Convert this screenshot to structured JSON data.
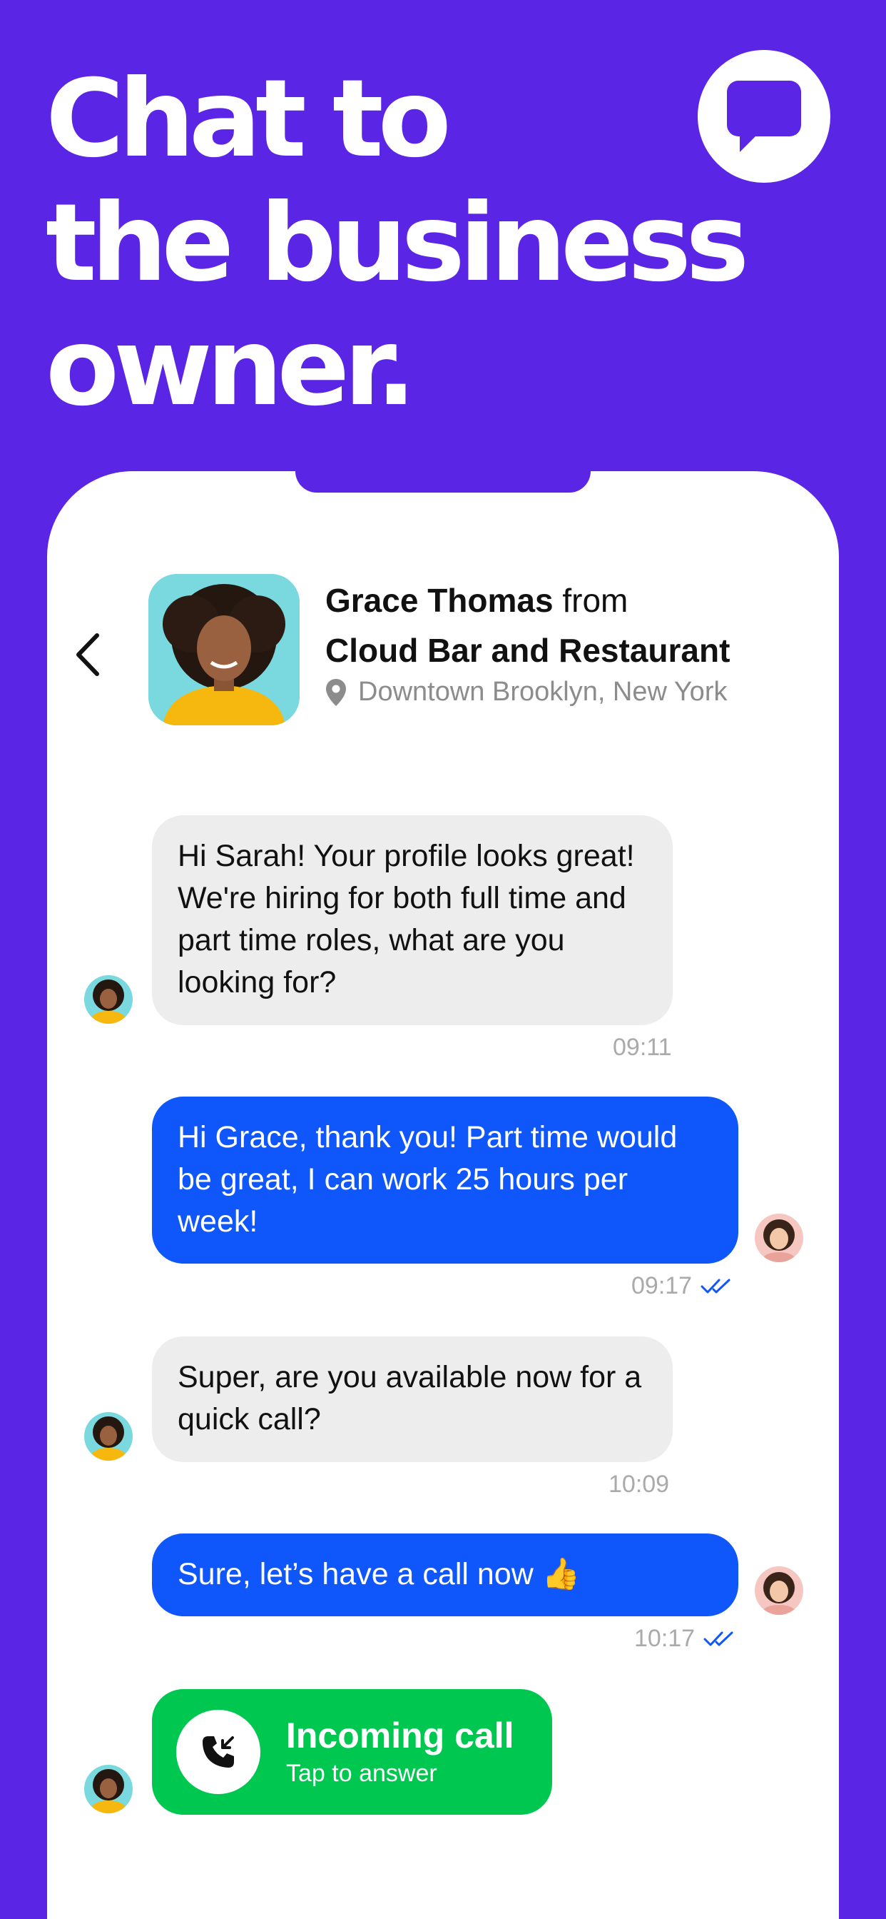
{
  "headline": {
    "line1": "Chat to",
    "line2": "the business",
    "line3": "owner."
  },
  "chat_header": {
    "name": "Grace Thomas",
    "from_word": "from",
    "business": "Cloud Bar and Restaurant",
    "location": "Downtown Brooklyn, New York"
  },
  "messages": [
    {
      "sender": "business",
      "text": "Hi Sarah! Your profile looks great! We're hiring for both full time and part time roles, what are you looking for?",
      "time": "09:11"
    },
    {
      "sender": "user",
      "text": "Hi Grace, thank you! Part time would be great, I can work 25 hours per week!",
      "time": "09:17"
    },
    {
      "sender": "business",
      "text": "Super, are you available now for a quick call?",
      "time": "10:09"
    },
    {
      "sender": "user",
      "text": "Sure, let’s have a call now 👍",
      "time": "10:17"
    }
  ],
  "call": {
    "title": "Incoming call",
    "subtitle": "Tap to answer"
  },
  "icons": {
    "logo": "chat-bubble-icon",
    "back": "chevron-left-icon",
    "location": "location-pin-icon",
    "read": "double-check-icon",
    "call": "phone-incoming-icon"
  },
  "colors": {
    "background": "#5b25e6",
    "outgoing": "#0f57fb",
    "incoming": "#ededed",
    "call": "#00c74f"
  }
}
